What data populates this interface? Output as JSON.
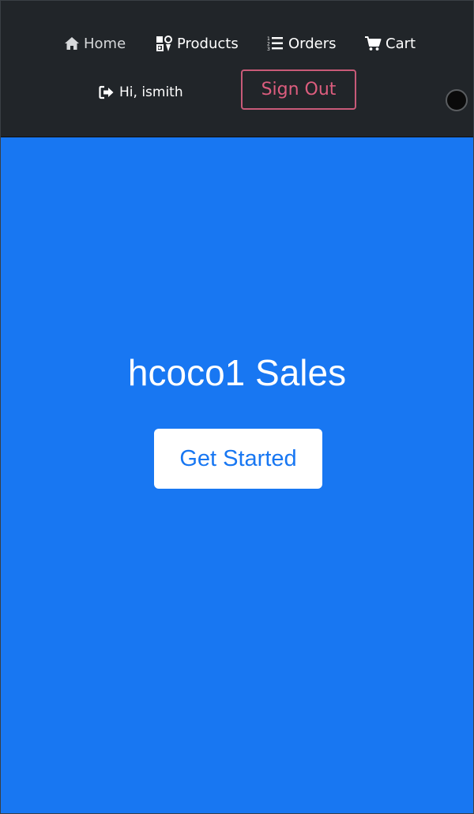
{
  "navbar": {
    "items": [
      {
        "label": "Home",
        "icon": "home-icon"
      },
      {
        "label": "Products",
        "icon": "products-icon"
      },
      {
        "label": "Orders",
        "icon": "orders-list-icon"
      },
      {
        "label": "Cart",
        "icon": "cart-icon"
      }
    ],
    "greeting": "Hi, ismith",
    "greeting_icon": "sign-in-icon",
    "sign_out_label": "Sign Out"
  },
  "hero": {
    "title": "hcoco1 Sales",
    "cta_label": "Get Started"
  },
  "colors": {
    "navbar_bg": "#212529",
    "hero_bg": "#1877f2",
    "sign_out_accent": "#dc5d7e",
    "cta_bg": "#ffffff",
    "cta_text": "#1877f2"
  }
}
